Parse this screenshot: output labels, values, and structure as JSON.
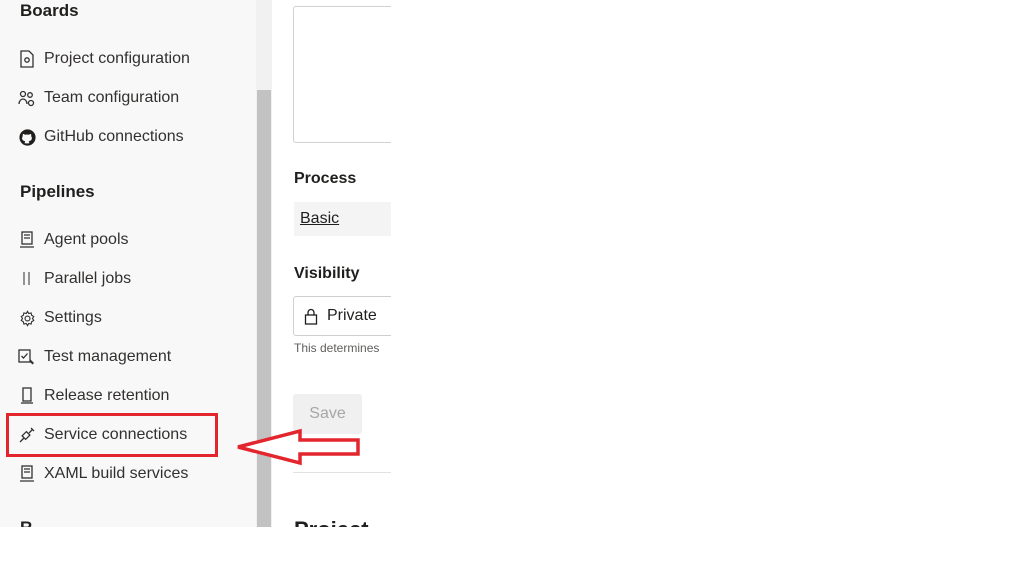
{
  "sidebar": {
    "boards_heading": "Boards",
    "boards_items": [
      {
        "label": "Project configuration",
        "icon": "project-config-icon"
      },
      {
        "label": "Team configuration",
        "icon": "team-icon"
      },
      {
        "label": "GitHub connections",
        "icon": "github-icon"
      }
    ],
    "pipelines_heading": "Pipelines",
    "pipelines_items": [
      {
        "label": "Agent pools",
        "icon": "agent-pool-icon"
      },
      {
        "label": "Parallel jobs",
        "icon": "parallel-jobs-icon"
      },
      {
        "label": "Settings",
        "icon": "gear-icon"
      },
      {
        "label": "Test management",
        "icon": "test-management-icon"
      },
      {
        "label": "Release retention",
        "icon": "release-retention-icon"
      },
      {
        "label": "Service connections",
        "icon": "service-connection-icon"
      },
      {
        "label": "XAML build services",
        "icon": "build-service-icon"
      }
    ],
    "next_heading_partial": "R"
  },
  "main": {
    "process_label": "Process",
    "process_value": "Basic",
    "visibility_label": "Visibility",
    "visibility_value": "Private",
    "visibility_icon": "lock-icon",
    "helper_text": "This determines",
    "save_label": "Save",
    "next_heading_partial": "Project"
  },
  "annotation": {
    "highlight_color": "#e3262d",
    "highlighted_item": "Service connections"
  }
}
